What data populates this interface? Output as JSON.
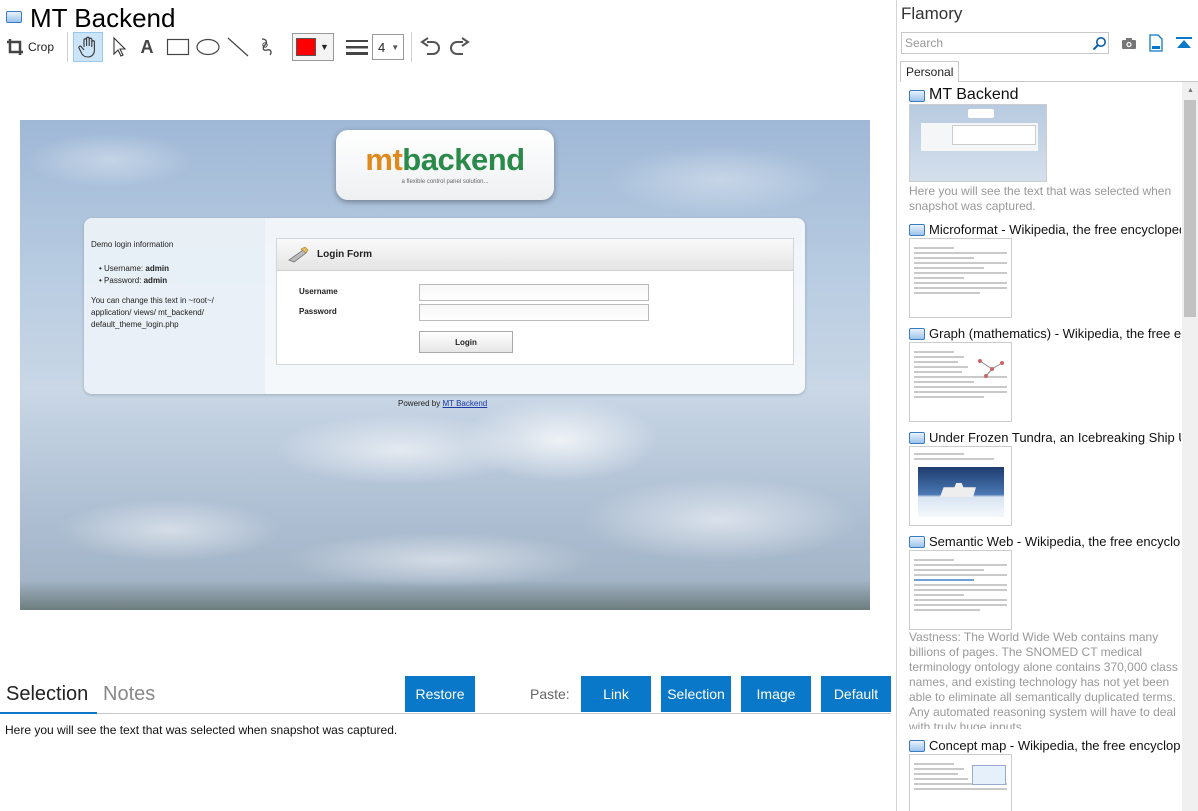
{
  "window": {
    "title": "MT Backend"
  },
  "toolbar": {
    "crop_label": "Crop",
    "text_tool_glyph": "A",
    "line_width": "4",
    "color": "#ff0000",
    "icons": [
      "crop-icon",
      "hand-icon",
      "pointer-icon",
      "text-icon",
      "rectangle-icon",
      "ellipse-icon",
      "line-icon",
      "freehand-icon",
      "color-picker",
      "line-style-icon",
      "undo-icon",
      "redo-icon"
    ]
  },
  "snapshot": {
    "logo_mt": "mt",
    "logo_backend": "backend",
    "tagline": "a flexible control panel solution...",
    "demo_heading": "Demo login information",
    "username_prefix": "Username: ",
    "username_value": "admin",
    "password_prefix": "Password: ",
    "password_value": "admin",
    "change_text": "You can change this text in ~root~/ application/ views/ mt_backend/ default_theme_login.php",
    "form_title": "Login Form",
    "username_label": "Username",
    "password_label": "Password",
    "login_button": "Login",
    "powered_by": "Powered by ",
    "powered_link": "MT Backend"
  },
  "bottom": {
    "tabs": [
      "Selection",
      "Notes"
    ],
    "restore_label": "Restore",
    "paste_label": "Paste:",
    "paste_buttons": [
      "Link",
      "Selection",
      "Image",
      "Default"
    ],
    "selection_text": "Here you will see the text that was selected when snapshot was captured."
  },
  "sidebar": {
    "app_name": "Flamory",
    "search_placeholder": "Search",
    "tab": "Personal",
    "items": [
      {
        "title": "MT Backend",
        "desc": "Here you will see the text that was selected when snapshot was captured."
      },
      {
        "title": "Microformat - Wikipedia, the free encyclopedia"
      },
      {
        "title": "Graph (mathematics) - Wikipedia, the free encyclopedia"
      },
      {
        "title": "Under Frozen Tundra, an Icebreaking Ship Uncovers"
      },
      {
        "title": "Semantic Web - Wikipedia, the free encyclopedia",
        "desc": "Vastness: The World Wide Web contains many billions of pages. The SNOMED CT medical terminology ontology alone contains 370,000 class names, and existing technology has not yet been able to eliminate all semantically duplicated terms. Any automated reasoning system will have to deal with truly huge inputs."
      },
      {
        "title": "Concept map - Wikipedia, the free encyclopedia"
      }
    ]
  },
  "colors": {
    "accent": "#0a78c8",
    "red": "#ff0000"
  }
}
